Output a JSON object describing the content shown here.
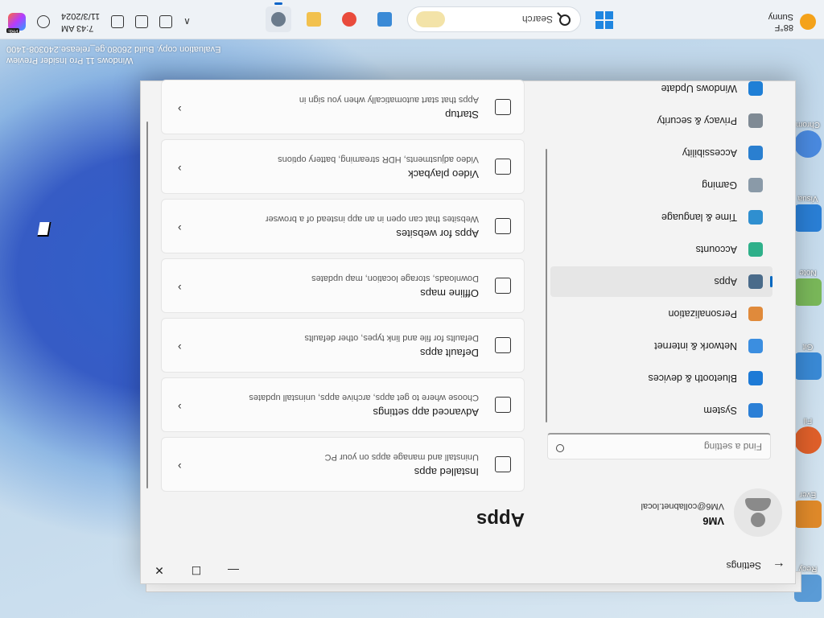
{
  "taskbar": {
    "weather_temp": "88°F",
    "weather_cond": "Sunny",
    "search_label": "Search",
    "time": "7:43 AM",
    "date": "11/3/2024",
    "copilot_badge": "PRE"
  },
  "watermark": {
    "line1": "Windows 11 Pro Insider Preview",
    "line2": "Evaluation copy. Build 26080.ge_release.240308-1400"
  },
  "desktop_icons": [
    "Recy",
    "Ever",
    "Fil",
    "Git",
    "Note",
    "Visua",
    "Chrom"
  ],
  "window": {
    "title": "Settings",
    "back": "←",
    "min": "—",
    "max": "☐",
    "close": "✕"
  },
  "user": {
    "name": "VM6",
    "email": "VM6@collabnet.local"
  },
  "search": {
    "placeholder": "Find a setting"
  },
  "nav": [
    {
      "label": "System",
      "color": "#2b7fd6"
    },
    {
      "label": "Bluetooth & devices",
      "color": "#1d7ad6"
    },
    {
      "label": "Network & internet",
      "color": "#3b8ee0"
    },
    {
      "label": "Personalization",
      "color": "#e08a3b"
    },
    {
      "label": "Apps",
      "color": "#4a6b8a"
    },
    {
      "label": "Accounts",
      "color": "#2fb08a"
    },
    {
      "label": "Time & language",
      "color": "#2f8fd0"
    },
    {
      "label": "Gaming",
      "color": "#8a9aa8"
    },
    {
      "label": "Accessibility",
      "color": "#2a7fd0"
    },
    {
      "label": "Privacy & security",
      "color": "#7f8a94"
    },
    {
      "label": "Windows Update",
      "color": "#1f7fd6"
    }
  ],
  "main": {
    "title": "Apps",
    "cards": [
      {
        "title": "Installed apps",
        "desc": "Uninstall and manage apps on your PC"
      },
      {
        "title": "Advanced app settings",
        "desc": "Choose where to get apps, archive apps, uninstall updates"
      },
      {
        "title": "Default apps",
        "desc": "Defaults for file and link types, other defaults"
      },
      {
        "title": "Offline maps",
        "desc": "Downloads, storage location, map updates"
      },
      {
        "title": "Apps for websites",
        "desc": "Websites that can open in an app instead of a browser"
      },
      {
        "title": "Video playback",
        "desc": "Video adjustments, HDR streaming, battery options"
      },
      {
        "title": "Startup",
        "desc": "Apps that start automatically when you sign in"
      }
    ],
    "chevron": "›"
  }
}
